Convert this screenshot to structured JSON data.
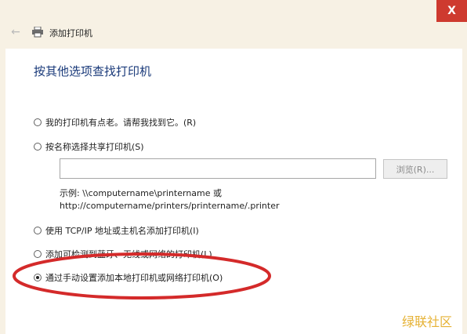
{
  "window": {
    "title": "添加打印机",
    "close_glyph": "X"
  },
  "main": {
    "heading": "按其他选项查找打印机",
    "options": [
      {
        "label": "我的打印机有点老。请帮我找到它。(R)",
        "selected": false
      },
      {
        "label": "按名称选择共享打印机(S)",
        "selected": false
      },
      {
        "label": "使用 TCP/IP 地址或主机名添加打印机(I)",
        "selected": false
      },
      {
        "label": "添加可检测到蓝牙、无线或网络的打印机(L)",
        "selected": false
      },
      {
        "label": "通过手动设置添加本地打印机或网络打印机(O)",
        "selected": true
      }
    ],
    "shared_name_input": {
      "value": "",
      "placeholder": ""
    },
    "browse_label": "浏览(R)...",
    "example_line1": "示例: \\\\computername\\printername 或",
    "example_line2": "http://computername/printers/printername/.printer"
  },
  "icons": {
    "back": "back-arrow-icon",
    "printer": "printer-icon",
    "close": "close-icon"
  },
  "colors": {
    "close_button": "#ce3a2f",
    "heading": "#1a3a7a",
    "annotation_ellipse": "#d42a2a",
    "watermark": "#e6b235"
  },
  "watermark": "绿联社区"
}
